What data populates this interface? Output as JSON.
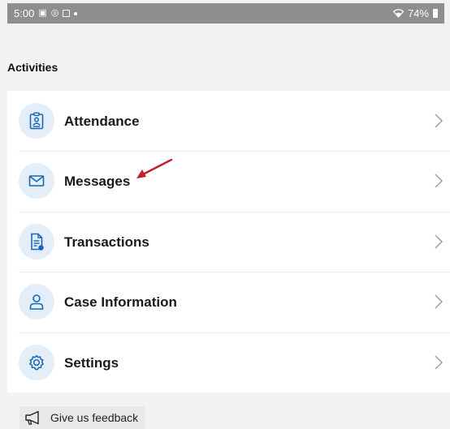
{
  "status_bar": {
    "time": "5:00",
    "battery": "74%"
  },
  "section_title": "Activities",
  "menu": [
    {
      "label": "Attendance",
      "icon": "clipboard-badge-icon"
    },
    {
      "label": "Messages",
      "icon": "envelope-icon"
    },
    {
      "label": "Transactions",
      "icon": "document-icon"
    },
    {
      "label": "Case Information",
      "icon": "person-icon"
    },
    {
      "label": "Settings",
      "icon": "gear-icon"
    }
  ],
  "feedback": {
    "label": "Give us feedback",
    "icon": "megaphone-icon"
  },
  "colors": {
    "accent": "#1668b6",
    "icon_bg": "#e3eef8",
    "annotation_arrow": "#c0202a",
    "status_bar": "#8e8e8e"
  }
}
